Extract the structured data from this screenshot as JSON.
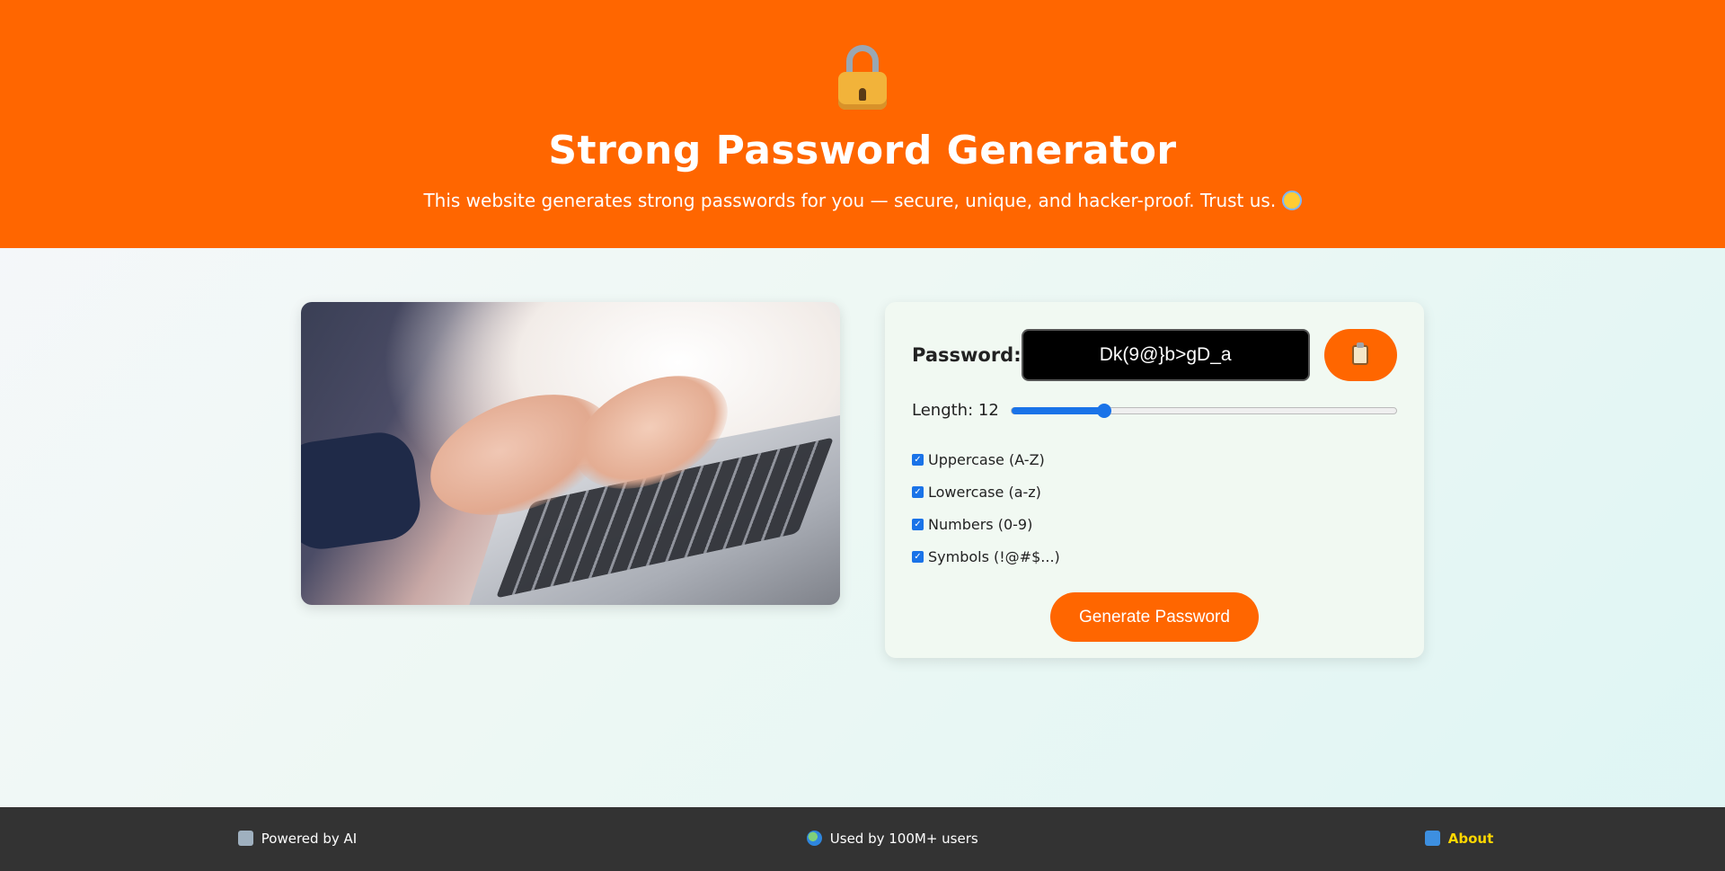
{
  "header": {
    "title": "Strong Password Generator",
    "subtitle": "This website generates strong passwords for you — secure, unique, and hacker-proof. Trust us.",
    "icon": "lock-icon",
    "background": "#ff6600"
  },
  "image": {
    "alt": "Hands typing on a laptop keyboard"
  },
  "generator": {
    "password_label": "Password:",
    "password_value": "Dk(9@}b>gD_a",
    "copy_icon": "clipboard-icon",
    "length_label": "Length: 12",
    "length_value": 12,
    "length_fraction": 0.24,
    "options": [
      {
        "label": "Uppercase (A-Z)",
        "checked": true
      },
      {
        "label": "Lowercase (a-z)",
        "checked": true
      },
      {
        "label": "Numbers (0-9)",
        "checked": true
      },
      {
        "label": "Symbols (!@#$...)",
        "checked": true
      }
    ],
    "generate_label": "Generate Password",
    "accent": "#ff6600"
  },
  "footer": {
    "powered": "Powered by AI",
    "users": "Used by 100M+ users",
    "about": "About"
  }
}
